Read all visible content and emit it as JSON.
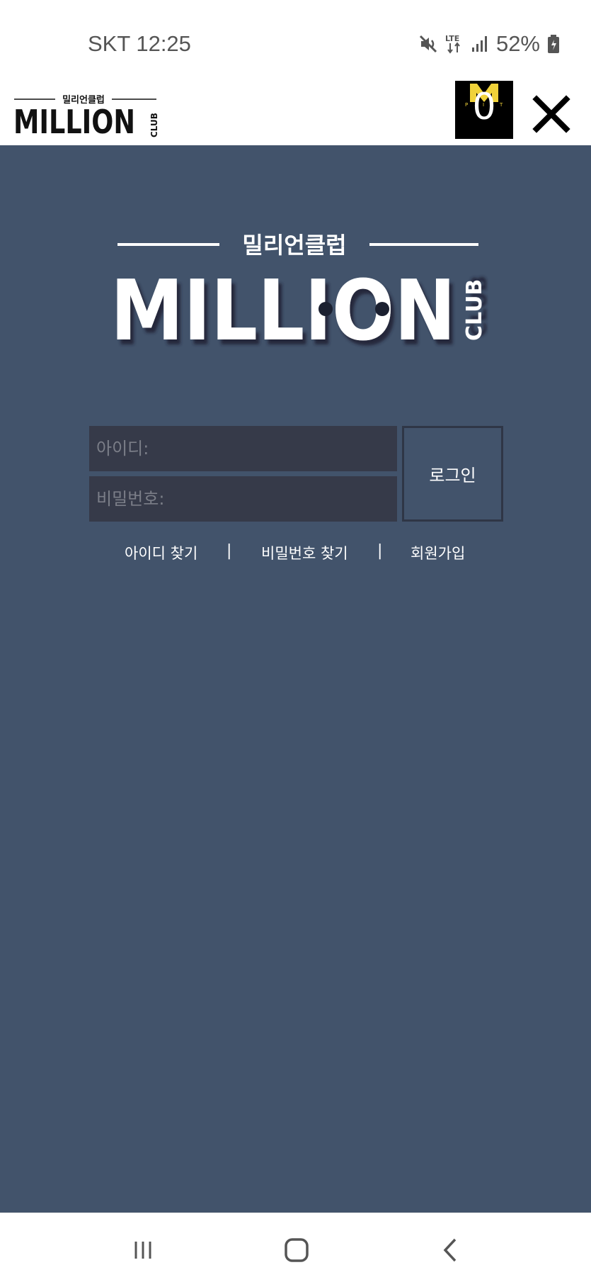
{
  "status_bar": {
    "time": "SKT 12:25",
    "battery": "52%",
    "icons": [
      "mute-icon",
      "lte-icon",
      "signal-icon",
      "battery-icon"
    ]
  },
  "header": {
    "logo_korean": "밀리언클럽",
    "logo_main": "MILLION",
    "logo_side": "CLUB",
    "badge_count": "0",
    "badge_letters": [
      "P",
      "I",
      "T"
    ],
    "close_icon": "close-icon"
  },
  "main": {
    "logo_korean": "밀리언클럽",
    "logo_main": "MILLION",
    "logo_side": "CLUB",
    "id_placeholder": "아이디:",
    "pw_placeholder": "비밀번호:",
    "login_label": "로그인",
    "links": {
      "find_id": "아이디 찾기",
      "find_pw": "비밀번호 찾기",
      "signup": "회원가입",
      "separator": "|"
    }
  },
  "nav_bar": {
    "icons": [
      "recent-apps-icon",
      "home-icon",
      "back-icon"
    ]
  },
  "colors": {
    "background": "#42536b",
    "input_bg": "#363a49",
    "badge_yellow": "#f0d23a"
  }
}
